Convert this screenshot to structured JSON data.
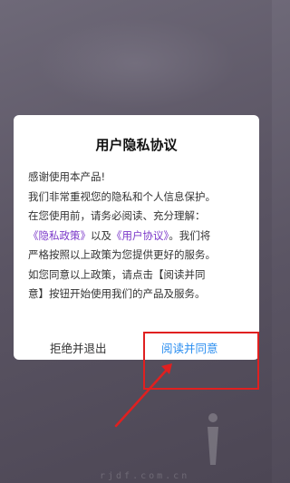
{
  "dialog": {
    "title": "用户隐私协议",
    "lines": {
      "l1": "感谢使用本产品!",
      "l2": "我们非常重视您的隐私和个人信息保护。",
      "l3": "在您使用前，请务必阅读、充分理解：",
      "l4_link1": "《隐私政策》",
      "l4_mid": "以及",
      "l4_link2": "《用户协议》",
      "l4_end": "。我们将",
      "l5": "严格按照以上政策为您提供更好的服务。",
      "l6": "如您同意以上政策，请点击【阅读并同",
      "l7": "意】按钮开始使用我们的产品及服务。"
    },
    "decline_label": "拒绝并退出",
    "accept_label": "阅读并同意"
  },
  "annotation": {
    "color": "#e02020"
  },
  "watermark": {
    "text": "rjdf.com.cn",
    "icon": "i-logo-icon"
  }
}
